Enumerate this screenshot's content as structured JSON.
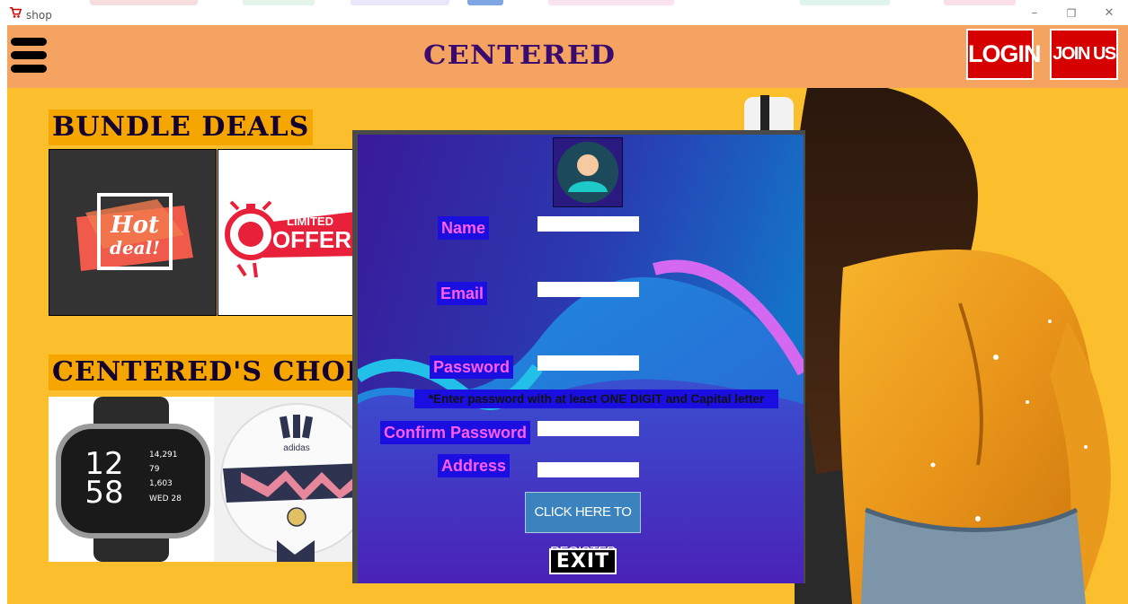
{
  "window": {
    "title": "shop",
    "controls": {
      "minimize": "–",
      "maximize": "❐",
      "close": "✕"
    }
  },
  "header": {
    "brand": "CENTERED",
    "login_label": "LOGIN",
    "join_label": "JOIN US NOW"
  },
  "sections": {
    "bundle_title": "BUNDLE DEALS",
    "choice_title": "CENTERED'S CHOIC",
    "bundle_tiles": [
      {
        "line1": "Hot",
        "line2": "deal!"
      },
      {
        "line1": "LIMITED",
        "line2": "OFFER"
      }
    ],
    "watch": {
      "time_h": "12",
      "time_m": "58",
      "steps": "14,291",
      "heart": "79",
      "cal": "1,603",
      "date": "WED 28"
    },
    "ball": {
      "brand": "adidas"
    }
  },
  "register": {
    "name_label": "Name",
    "email_label": "Email",
    "password_label": "Password",
    "password_hint": "*Enter password with at least ONE DIGIT and Capital letter",
    "confirm_label": "Confirm Password",
    "address_label": "Address",
    "register_button": "CLICK HERE TO REGISTER",
    "exit_button": "EXIT",
    "fields": {
      "name": "",
      "email": "",
      "password": "",
      "confirm": "",
      "address": ""
    }
  },
  "colors": {
    "header_bg": "#f4a460",
    "main_bg": "#fbbf2e",
    "accent_red": "#d60000",
    "label_bg": "#1a0fe0",
    "label_text": "#ff5cf3",
    "brand_text": "#3a0a6e"
  },
  "icons": {
    "app": "shopping-cart-icon",
    "menu": "hamburger-icon",
    "avatar": "user-avatar-icon"
  }
}
